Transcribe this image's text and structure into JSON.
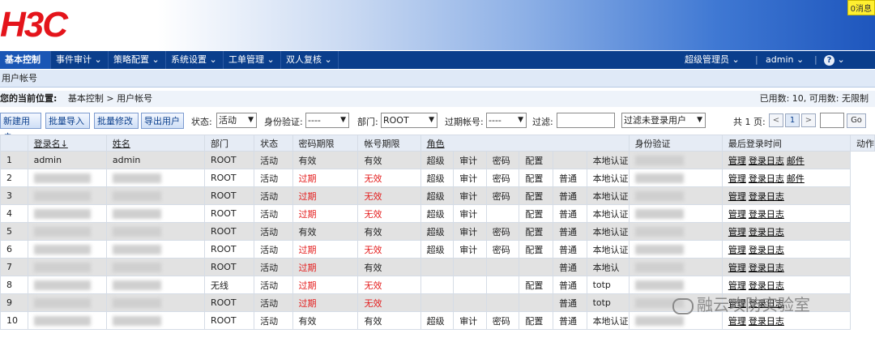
{
  "header": {
    "logo": "H3C",
    "message_badge": "0消息"
  },
  "nav": {
    "items": [
      "基本控制",
      "事件审计 ⌄",
      "策略配置 ⌄",
      "系统设置 ⌄",
      "工单管理 ⌄",
      "双人复核 ⌄"
    ],
    "role": "超级管理员 ⌄",
    "user": "admin ⌄",
    "help_icon": "question-icon"
  },
  "subbar": {
    "title": "用户帐号"
  },
  "location": {
    "label": "您的当前位置:",
    "path": "基本控制 > 用户帐号",
    "usage": "已用数: 10, 可用数: 无限制"
  },
  "toolbar": {
    "buttons": [
      "新建用户",
      "批量导入",
      "批量修改",
      "导出用户"
    ],
    "status_label": "状态:",
    "status_value": "活动",
    "auth_label": "身份验证:",
    "auth_value": "----",
    "dept_label": "部门:",
    "dept_value": "ROOT",
    "expired_label": "过期帐号:",
    "expired_value": "----",
    "filter_label": "过滤:",
    "filter_value": "",
    "filter_select": "过滤未登录用户",
    "page_label": "共 1 页:",
    "page_prev": "<",
    "page_current": "1",
    "page_next": ">",
    "page_input": "",
    "go": "Go"
  },
  "table": {
    "headers": [
      "",
      "登录名↓",
      "姓名",
      "部门",
      "状态",
      "密码期限",
      "帐号期限",
      "角色",
      "身份验证",
      "最后登录时间",
      "动作"
    ],
    "rows": [
      {
        "n": "1",
        "login": "admin",
        "name": "admin",
        "dept": "ROOT",
        "status": "活动",
        "pwd": "有效",
        "acct": "有效",
        "r1": "超级",
        "r2": "审计",
        "r3": "密码",
        "r4": "配置",
        "r5": "",
        "auth": "本地认证",
        "actions": [
          "管理",
          "登录日志",
          "邮件"
        ]
      },
      {
        "n": "2",
        "login": "",
        "name": "",
        "dept": "ROOT",
        "status": "活动",
        "pwd": "过期",
        "acct": "无效",
        "r1": "超级",
        "r2": "审计",
        "r3": "密码",
        "r4": "配置",
        "r5": "普通",
        "auth": "本地认证",
        "actions": [
          "管理",
          "登录日志",
          "邮件"
        ]
      },
      {
        "n": "3",
        "login": "",
        "name": "",
        "dept": "ROOT",
        "status": "活动",
        "pwd": "过期",
        "acct": "无效",
        "r1": "超级",
        "r2": "审计",
        "r3": "密码",
        "r4": "配置",
        "r5": "普通",
        "auth": "本地认证",
        "actions": [
          "管理",
          "登录日志"
        ]
      },
      {
        "n": "4",
        "login": "",
        "name": "",
        "dept": "ROOT",
        "status": "活动",
        "pwd": "过期",
        "acct": "无效",
        "r1": "超级",
        "r2": "审计",
        "r3": "",
        "r4": "配置",
        "r5": "普通",
        "auth": "本地认证",
        "actions": [
          "管理",
          "登录日志"
        ]
      },
      {
        "n": "5",
        "login": "",
        "name": "",
        "dept": "ROOT",
        "status": "活动",
        "pwd": "有效",
        "acct": "有效",
        "r1": "超级",
        "r2": "审计",
        "r3": "密码",
        "r4": "配置",
        "r5": "普通",
        "auth": "本地认证",
        "actions": [
          "管理",
          "登录日志"
        ]
      },
      {
        "n": "6",
        "login": "",
        "name": "",
        "dept": "ROOT",
        "status": "活动",
        "pwd": "过期",
        "acct": "无效",
        "r1": "超级",
        "r2": "审计",
        "r3": "密码",
        "r4": "配置",
        "r5": "普通",
        "auth": "本地认证",
        "actions": [
          "管理",
          "登录日志"
        ]
      },
      {
        "n": "7",
        "login": "",
        "name": "",
        "dept": "ROOT",
        "status": "活动",
        "pwd": "过期",
        "acct": "有效",
        "r1": "",
        "r2": "",
        "r3": "",
        "r4": "",
        "r5": "普通",
        "auth": "本地认",
        "actions": [
          "管理",
          "登录日志"
        ]
      },
      {
        "n": "8",
        "login": "",
        "name": "",
        "dept": "无线",
        "status": "活动",
        "pwd": "过期",
        "acct": "无效",
        "r1": "",
        "r2": "",
        "r3": "",
        "r4": "配置",
        "r5": "普通",
        "auth": "totp",
        "actions": [
          "管理",
          "登录日志"
        ]
      },
      {
        "n": "9",
        "login": "",
        "name": "",
        "dept": "ROOT",
        "status": "活动",
        "pwd": "过期",
        "acct": "无效",
        "r1": "",
        "r2": "",
        "r3": "",
        "r4": "",
        "r5": "普通",
        "auth": "totp",
        "actions": [
          "管理",
          "登录日志"
        ]
      },
      {
        "n": "10",
        "login": "",
        "name": "",
        "dept": "ROOT",
        "status": "活动",
        "pwd": "有效",
        "acct": "有效",
        "r1": "超级",
        "r2": "审计",
        "r3": "密码",
        "r4": "配置",
        "r5": "普通",
        "auth": "本地认证",
        "actions": [
          "管理",
          "登录日志"
        ]
      }
    ]
  },
  "watermark": {
    "text": "融云攻防实验室",
    "icon": "wechat-icon"
  },
  "colors": {
    "nav_bg": "#0a3e8c",
    "expired_red": "#e41c1c",
    "logo_red": "#e4141b"
  }
}
